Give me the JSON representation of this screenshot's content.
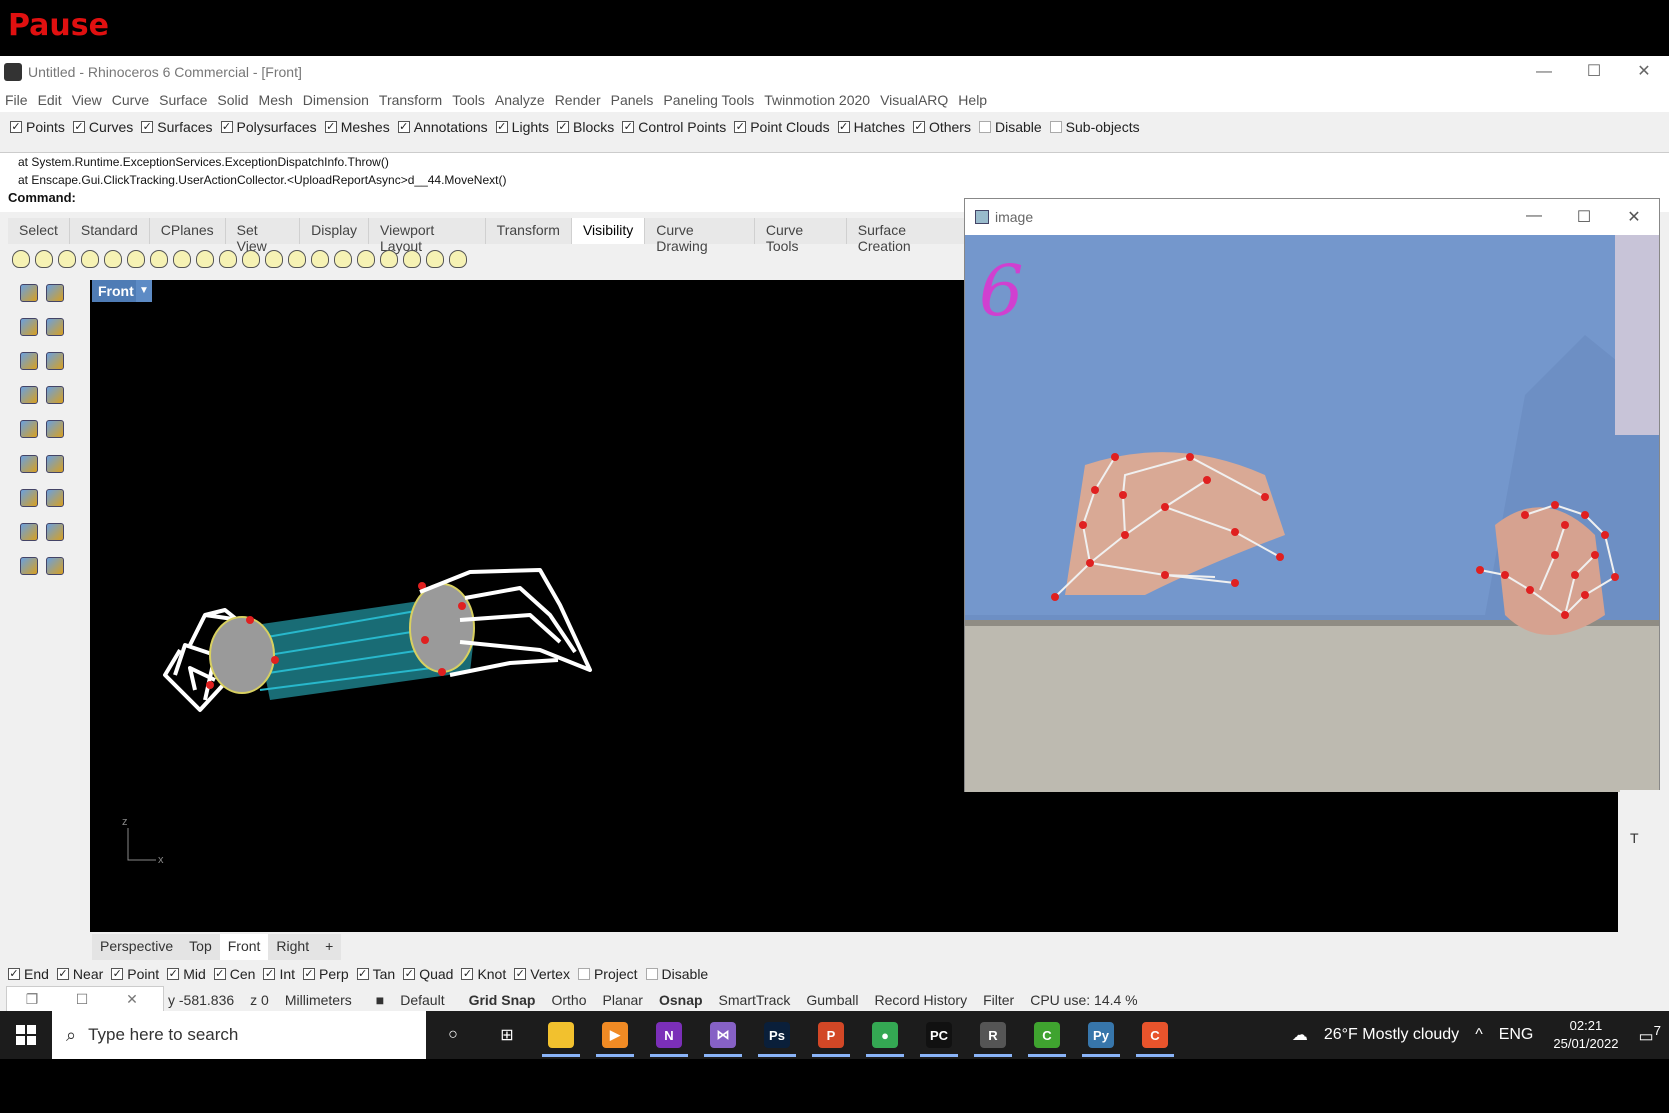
{
  "overlay": {
    "pause_label": "Pause"
  },
  "window": {
    "title": "Untitled - Rhinoceros 6 Commercial - [Front]",
    "minimize": "—",
    "maximize": "☐",
    "close": "✕"
  },
  "menu": [
    "File",
    "Edit",
    "View",
    "Curve",
    "Surface",
    "Solid",
    "Mesh",
    "Dimension",
    "Transform",
    "Tools",
    "Analyze",
    "Render",
    "Panels",
    "Paneling Tools",
    "Twinmotion 2020",
    "VisualARQ",
    "Help"
  ],
  "filters": [
    {
      "label": "Points",
      "checked": true
    },
    {
      "label": "Curves",
      "checked": true
    },
    {
      "label": "Surfaces",
      "checked": true
    },
    {
      "label": "Polysurfaces",
      "checked": true
    },
    {
      "label": "Meshes",
      "checked": true
    },
    {
      "label": "Annotations",
      "checked": true
    },
    {
      "label": "Lights",
      "checked": true
    },
    {
      "label": "Blocks",
      "checked": true
    },
    {
      "label": "Control Points",
      "checked": true
    },
    {
      "label": "Point Clouds",
      "checked": true
    },
    {
      "label": "Hatches",
      "checked": true
    },
    {
      "label": "Others",
      "checked": true
    },
    {
      "label": "Disable",
      "checked": false
    },
    {
      "label": "Sub-objects",
      "checked": false
    }
  ],
  "command": {
    "history_line1": "at System.Runtime.ExceptionServices.ExceptionDispatchInfo.Throw()",
    "history_line2": "at Enscape.Gui.ClickTracking.UserActionCollector.<UploadReportAsync>d__44.MoveNext()",
    "prompt": "Command:"
  },
  "toolbar_tabs": [
    "Select",
    "Standard",
    "CPlanes",
    "Set View",
    "Display",
    "Viewport Layout",
    "Transform",
    "Visibility",
    "Curve Drawing",
    "Curve Tools",
    "Surface Creation"
  ],
  "active_toolbar_tab": "Visibility",
  "viewport": {
    "name": "Front",
    "dropdown_glyph": "▼",
    "axis_z": "z",
    "axis_x": "x"
  },
  "view_tabs": [
    "Perspective",
    "Top",
    "Front",
    "Right"
  ],
  "view_tab_add": "+",
  "active_view_tab": "Front",
  "osnaps": [
    {
      "label": "End",
      "checked": true
    },
    {
      "label": "Near",
      "checked": true
    },
    {
      "label": "Point",
      "checked": true
    },
    {
      "label": "Mid",
      "checked": true
    },
    {
      "label": "Cen",
      "checked": true
    },
    {
      "label": "Int",
      "checked": true
    },
    {
      "label": "Perp",
      "checked": true
    },
    {
      "label": "Tan",
      "checked": true
    },
    {
      "label": "Quad",
      "checked": true
    },
    {
      "label": "Knot",
      "checked": true
    },
    {
      "label": "Vertex",
      "checked": true
    },
    {
      "label": "Project",
      "checked": false
    },
    {
      "label": "Disable",
      "checked": false
    }
  ],
  "status": {
    "y_coord": "y -581.836",
    "z_coord": "z 0",
    "units": "Millimeters",
    "layer": "Default",
    "toggles": [
      "Grid Snap",
      "Ortho",
      "Planar",
      "Osnap",
      "SmartTrack",
      "Gumball",
      "Record History",
      "Filter"
    ],
    "cpu": "CPU use: 14.4 %"
  },
  "image_window": {
    "title": "image",
    "finger_count": "6",
    "minimize": "—",
    "maximize": "☐",
    "close": "✕"
  },
  "right_panel_char": "T",
  "taskbar": {
    "search_placeholder": "Type here to search",
    "weather": "26°F  Mostly cloudy",
    "language": "ENG",
    "time": "02:21",
    "date": "25/01/2022",
    "notification_count": "7",
    "apps": [
      {
        "name": "file-explorer",
        "label": "",
        "color": "#f2c12e"
      },
      {
        "name": "media-player",
        "label": "▶",
        "color": "#f08a24"
      },
      {
        "name": "onenote",
        "label": "N",
        "color": "#7b2fb8"
      },
      {
        "name": "visual-studio",
        "label": "⋈",
        "color": "#8661c5"
      },
      {
        "name": "photoshop",
        "label": "Ps",
        "color": "#0a1f3a"
      },
      {
        "name": "powerpoint",
        "label": "P",
        "color": "#d24726"
      },
      {
        "name": "chrome",
        "label": "●",
        "color": "#34a853"
      },
      {
        "name": "pycharm",
        "label": "PC",
        "color": "#111111"
      },
      {
        "name": "rhino",
        "label": "R",
        "color": "#555555"
      },
      {
        "name": "camtasia",
        "label": "C",
        "color": "#3fa32f"
      },
      {
        "name": "python",
        "label": "Py",
        "color": "#3776ab"
      },
      {
        "name": "recorder",
        "label": "C",
        "color": "#e8542c"
      }
    ]
  },
  "colors": {
    "pause": "#e01010",
    "viewport_bg": "#000000",
    "hand_wire": "#ffffff",
    "forearm": "#2ec4d6",
    "landmark": "#e02020",
    "digit": "#d040d0",
    "camera_shirt": "#6d8fc4",
    "camera_table": "#bdbab0"
  }
}
